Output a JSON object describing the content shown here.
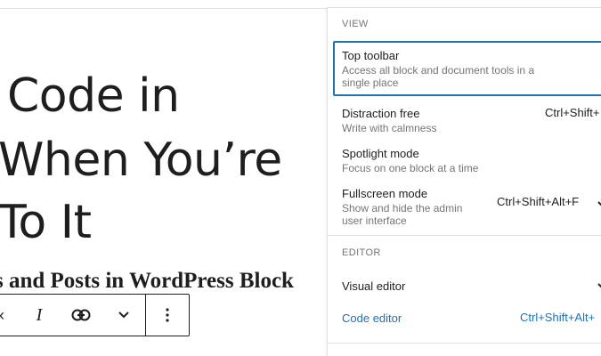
{
  "editor": {
    "title_lines": [
      " Code in",
      "When You’re",
      "To It"
    ],
    "subheading": "s and Posts in WordPress Block"
  },
  "block_toolbar": {
    "cut_label": "‹",
    "italic_label": "I"
  },
  "options_menu": {
    "view_label": "VIEW",
    "editor_label": "EDITOR",
    "view_items": [
      {
        "label": "Top toolbar",
        "description": "Access all block and document tools in a single place",
        "shortcut": ""
      },
      {
        "label": "Distraction free",
        "description": "Write with calmness",
        "shortcut": "Ctrl+Shift+"
      },
      {
        "label": "Spotlight mode",
        "description": "Focus on one block at a time",
        "shortcut": ""
      },
      {
        "label": "Fullscreen mode",
        "description": "Show and hide the admin user interface",
        "shortcut": "Ctrl+Shift+Alt+F"
      }
    ],
    "editor_items": [
      {
        "label": "Visual editor",
        "shortcut": ""
      },
      {
        "label": "Code editor",
        "shortcut": "Ctrl+Shift+Alt+"
      }
    ]
  },
  "colors": {
    "accent": "#2271b1",
    "text": "#1e1e1e",
    "muted": "#757575",
    "border": "#e0e0e0"
  }
}
